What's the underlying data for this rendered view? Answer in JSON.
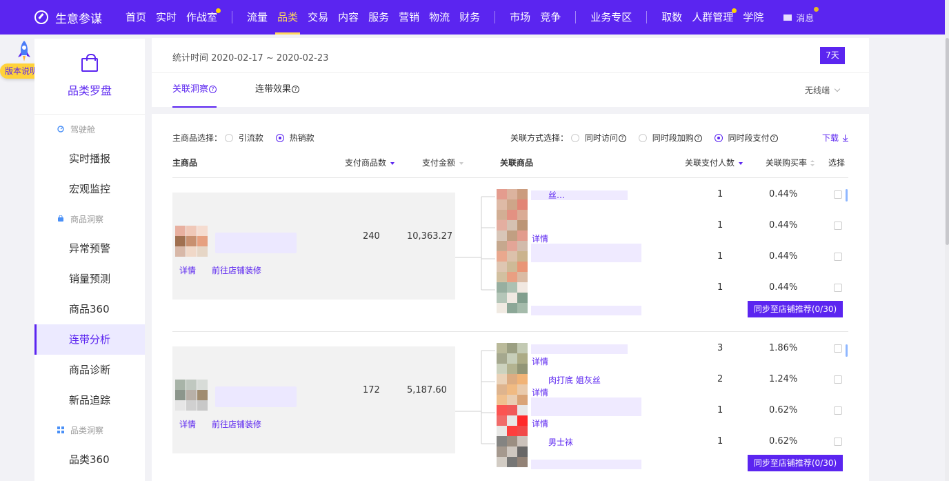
{
  "nav": {
    "brand": "生意参谋",
    "items": [
      {
        "label": "首页",
        "dot": false,
        "active": false
      },
      {
        "label": "实时",
        "dot": false,
        "active": false
      },
      {
        "label": "作战室",
        "dot": true,
        "active": false
      },
      {
        "sep": true
      },
      {
        "label": "流量",
        "dot": false,
        "active": false
      },
      {
        "label": "品类",
        "dot": false,
        "active": true
      },
      {
        "label": "交易",
        "dot": false,
        "active": false
      },
      {
        "label": "内容",
        "dot": false,
        "active": false
      },
      {
        "label": "服务",
        "dot": false,
        "active": false
      },
      {
        "label": "营销",
        "dot": false,
        "active": false
      },
      {
        "label": "物流",
        "dot": false,
        "active": false
      },
      {
        "label": "财务",
        "dot": false,
        "active": false
      },
      {
        "sep": true
      },
      {
        "label": "市场",
        "dot": false,
        "active": false
      },
      {
        "label": "竞争",
        "dot": false,
        "active": false
      },
      {
        "sep": true
      },
      {
        "label": "业务专区",
        "dot": false,
        "active": false
      },
      {
        "sep": true
      },
      {
        "label": "取数",
        "dot": false,
        "active": false
      },
      {
        "label": "人群管理",
        "dot": true,
        "active": false
      },
      {
        "label": "学院",
        "dot": false,
        "active": false
      }
    ],
    "messages": "消息",
    "accent": "#5b25f0",
    "active_color": "#ffd75e"
  },
  "version_badge": "版本说明",
  "sidebar": {
    "title": "品类罗盘",
    "sections": [
      {
        "group": "驾驶舱",
        "icon": "dashboard-icon",
        "items": [
          "实时播报",
          "宏观监控"
        ]
      },
      {
        "group": "商品洞察",
        "icon": "bag-icon",
        "items": [
          "异常预警",
          "销量预测",
          "商品360",
          "连带分析",
          "商品诊断",
          "新品追踪"
        ]
      },
      {
        "group": "品类洞察",
        "icon": "grid-icon",
        "items": [
          "品类360"
        ]
      }
    ],
    "active_item": "连带分析"
  },
  "header": {
    "stat_time": "统计时间 2020-02-17 ~ 2020-02-23",
    "range": "7天",
    "tabs": [
      "关联洞察",
      "连带效果"
    ],
    "active_tab": "关联洞察",
    "device": "无线端"
  },
  "filters": {
    "main_label": "主商品选择：",
    "main_options": [
      "引流款",
      "热销款"
    ],
    "main_selected": "热销款",
    "relation_label": "关联方式选择：",
    "relation_options": [
      "同时访问",
      "同时段加购",
      "同时段支付"
    ],
    "relation_selected": "同时段支付",
    "download": "下载"
  },
  "columns": {
    "main_product": "主商品",
    "pay_items": "支付商品数",
    "pay_amount": "支付金额",
    "related": "关联商品",
    "related_buyers": "关联支付人数",
    "related_rate": "关联购买率",
    "select": "选择"
  },
  "groups": [
    {
      "pay_items": "240",
      "pay_amount": "10,363.27",
      "detail": "详情",
      "decorate": "前往店铺装修",
      "related": [
        {
          "text": "丝…",
          "detail": "",
          "buyers": "1",
          "rate": "0.44%"
        },
        {
          "text": "",
          "detail": "详情",
          "buyers": "1",
          "rate": "0.44%"
        },
        {
          "text": "",
          "detail": "",
          "buyers": "1",
          "rate": "0.44%"
        },
        {
          "text": "",
          "detail": "",
          "buyers": "1",
          "rate": "0.44%"
        }
      ],
      "sync": "同步至店铺推荐(0/30)"
    },
    {
      "pay_items": "172",
      "pay_amount": "5,187.60",
      "detail": "详情",
      "decorate": "前往店铺装修",
      "related": [
        {
          "text": "",
          "detail": "详情",
          "buyers": "3",
          "rate": "1.86%"
        },
        {
          "text": "肉打底     姐灰丝",
          "detail": "详情",
          "buyers": "2",
          "rate": "1.24%"
        },
        {
          "text": "",
          "detail": "详情",
          "buyers": "1",
          "rate": "0.62%"
        },
        {
          "text": "男士袜",
          "detail": "",
          "buyers": "1",
          "rate": "0.62%"
        }
      ],
      "sync": "同步至店铺推荐(0/30)"
    }
  ]
}
